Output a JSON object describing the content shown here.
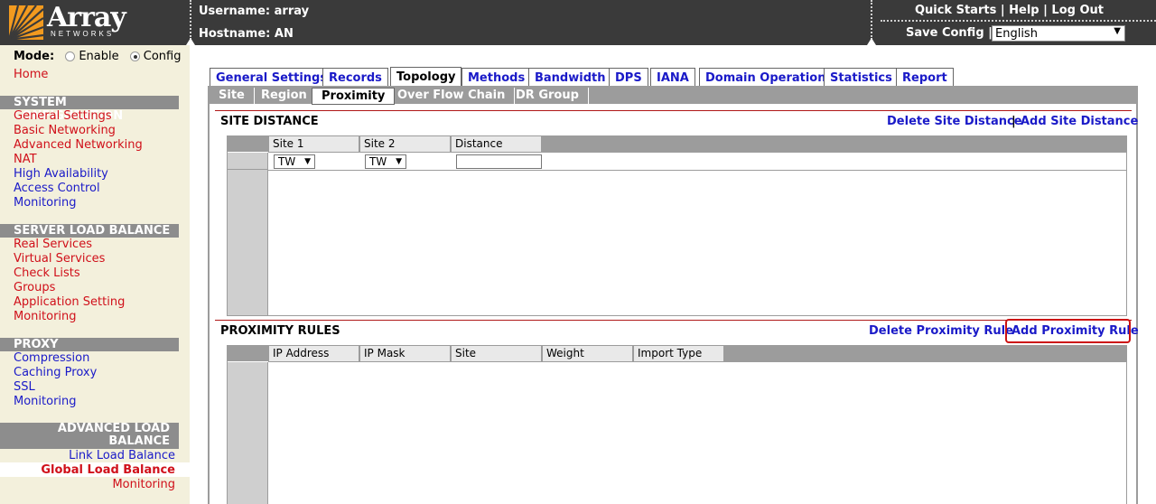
{
  "header": {
    "logo_word": "Array",
    "logo_sub": "NETWORKS",
    "username_label": "Username: array",
    "hostname_label": "Hostname: AN",
    "quick_starts": "Quick Starts",
    "help": "Help",
    "logout": "Log Out",
    "sep": " | ",
    "save_config": "Save Config |",
    "language": "English"
  },
  "sidebar": {
    "mode_label": "Mode:",
    "mode_enable": "Enable",
    "mode_config": "Config",
    "home": "Home",
    "system_configuration": {
      "title": "SYSTEM CONFIGURATION",
      "items": [
        "General Settings",
        "Basic Networking",
        "Advanced Networking",
        "NAT",
        "High Availability",
        "Access Control",
        "Monitoring"
      ]
    },
    "server_load_balance": {
      "title": "SERVER LOAD BALANCE",
      "items": [
        "Real Services",
        "Virtual Services",
        "Check Lists",
        "Groups",
        "Application Setting",
        "Monitoring"
      ]
    },
    "proxy": {
      "title": "PROXY",
      "items": [
        "Compression",
        "Caching Proxy",
        "SSL",
        "Monitoring"
      ]
    },
    "advanced_load_balance": {
      "title_line1": "ADVANCED LOAD",
      "title_line2": "BALANCE",
      "items": [
        "Link Load Balance",
        "Global Load Balance",
        "Monitoring"
      ]
    }
  },
  "tabs": [
    "General Settings",
    "Records",
    "Topology",
    "Methods",
    "Bandwidth",
    "DPS",
    "IANA",
    "Domain Operation",
    "Statistics",
    "Report"
  ],
  "active_tab": "Topology",
  "subtabs": [
    "Site",
    "Region",
    "Proximity",
    "Over Flow Chain",
    "DR Group"
  ],
  "active_subtab": "Proximity",
  "site_distance": {
    "title": "SITE DISTANCE",
    "delete_link": "Delete Site Distance",
    "sep": "|",
    "add_link": "Add Site Distance",
    "columns": [
      "Site 1",
      "Site 2",
      "Distance"
    ],
    "site1_value": "TW",
    "site2_value": "TW",
    "distance_value": ""
  },
  "proximity_rules": {
    "title": "PROXIMITY RULES",
    "delete_link": "Delete Proximity Rule",
    "add_link": "Add Proximity Rule",
    "columns": [
      "IP Address",
      "IP Mask",
      "Site",
      "Weight",
      "Import Type"
    ]
  },
  "colors": {
    "header_bg": "#3a3a3a",
    "sidebar_bg": "#f3f0dc",
    "section_header_bg": "#8d8d8d",
    "link_red": "#d0101a",
    "link_blue": "#1a1ac8",
    "highlight_box": "#cc1111",
    "logo_orange": "#f29a1f"
  }
}
